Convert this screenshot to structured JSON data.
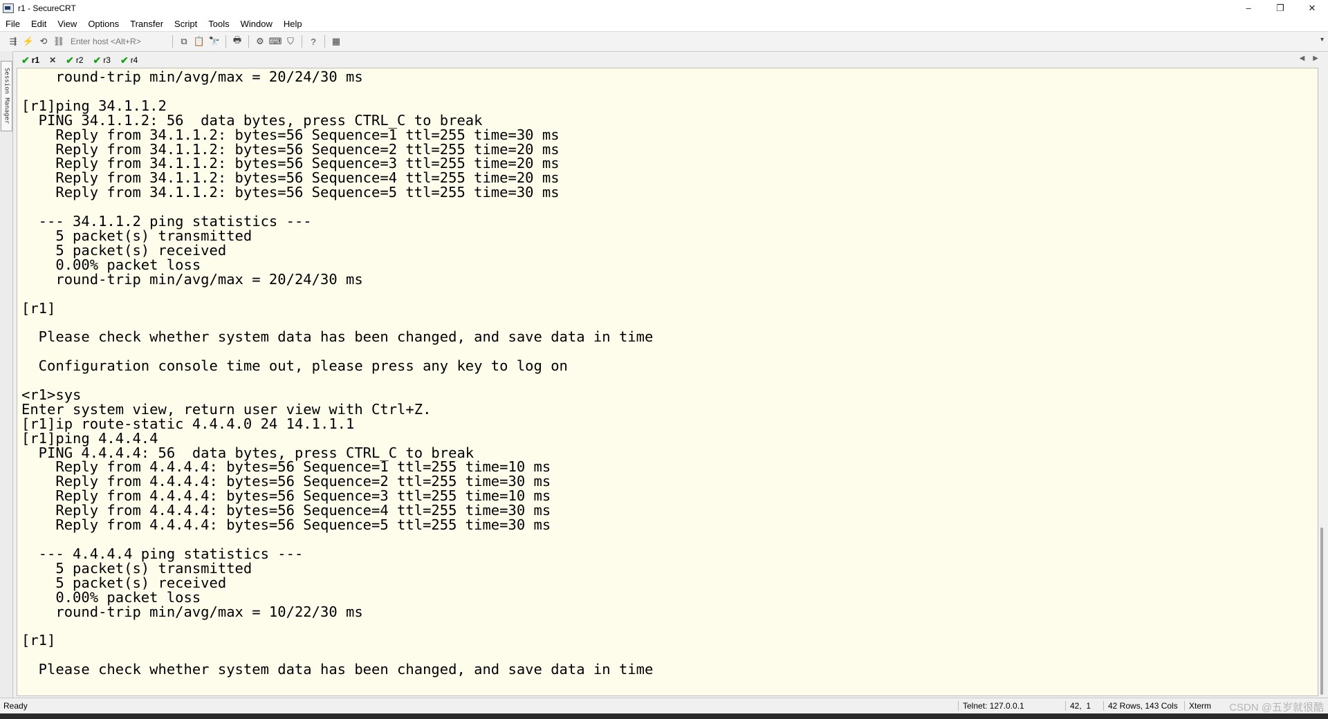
{
  "window": {
    "title": "r1 - SecureCRT",
    "controls": {
      "minimize": "–",
      "restore": "❐",
      "close": "✕"
    }
  },
  "menu": [
    "File",
    "Edit",
    "View",
    "Options",
    "Transfer",
    "Script",
    "Tools",
    "Window",
    "Help"
  ],
  "toolbar": {
    "host_placeholder": "Enter host <Alt+R>",
    "icons": [
      "connect-icon",
      "quick-connect-icon",
      "reconnect-icon",
      "disconnect-icon",
      "copy-icon",
      "paste-icon",
      "find-icon",
      "print-icon",
      "settings-icon",
      "keymap-icon",
      "sftp-icon",
      "help-icon",
      "session-options-icon"
    ]
  },
  "session_manager": {
    "label": "Session Manager"
  },
  "tabs": [
    {
      "label": "r1",
      "active": true,
      "status": "connected"
    },
    {
      "label": "r2",
      "active": false,
      "status": "connected"
    },
    {
      "label": "r3",
      "active": false,
      "status": "connected"
    },
    {
      "label": "r4",
      "active": false,
      "status": "connected"
    }
  ],
  "terminal": {
    "lines": [
      "    round-trip min/avg/max = 20/24/30 ms",
      "",
      "[r1]ping 34.1.1.2",
      "  PING 34.1.1.2: 56  data bytes, press CTRL_C to break",
      "    Reply from 34.1.1.2: bytes=56 Sequence=1 ttl=255 time=30 ms",
      "    Reply from 34.1.1.2: bytes=56 Sequence=2 ttl=255 time=20 ms",
      "    Reply from 34.1.1.2: bytes=56 Sequence=3 ttl=255 time=20 ms",
      "    Reply from 34.1.1.2: bytes=56 Sequence=4 ttl=255 time=20 ms",
      "    Reply from 34.1.1.2: bytes=56 Sequence=5 ttl=255 time=30 ms",
      "",
      "  --- 34.1.1.2 ping statistics ---",
      "    5 packet(s) transmitted",
      "    5 packet(s) received",
      "    0.00% packet loss",
      "    round-trip min/avg/max = 20/24/30 ms",
      "",
      "[r1]",
      "",
      "  Please check whether system data has been changed, and save data in time",
      "",
      "  Configuration console time out, please press any key to log on",
      "",
      "<r1>sys",
      "Enter system view, return user view with Ctrl+Z.",
      "[r1]ip route-static 4.4.4.0 24 14.1.1.1",
      "[r1]ping 4.4.4.4",
      "  PING 4.4.4.4: 56  data bytes, press CTRL_C to break",
      "    Reply from 4.4.4.4: bytes=56 Sequence=1 ttl=255 time=10 ms",
      "    Reply from 4.4.4.4: bytes=56 Sequence=2 ttl=255 time=30 ms",
      "    Reply from 4.4.4.4: bytes=56 Sequence=3 ttl=255 time=10 ms",
      "    Reply from 4.4.4.4: bytes=56 Sequence=4 ttl=255 time=30 ms",
      "    Reply from 4.4.4.4: bytes=56 Sequence=5 ttl=255 time=30 ms",
      "",
      "  --- 4.4.4.4 ping statistics ---",
      "    5 packet(s) transmitted",
      "    5 packet(s) received",
      "    0.00% packet loss",
      "    round-trip min/avg/max = 10/22/30 ms",
      "",
      "[r1]",
      "",
      "  Please check whether system data has been changed, and save data in time"
    ]
  },
  "status": {
    "ready": "Ready",
    "connection": "Telnet: 127.0.0.1",
    "cursor": "42,  1",
    "size": "42 Rows, 143 Cols",
    "terminal_type": "Xterm",
    "watermark": "CSDN @五岁就很酷"
  },
  "colors": {
    "terminal_bg": "#fefdec",
    "connected_check": "#18a018"
  }
}
